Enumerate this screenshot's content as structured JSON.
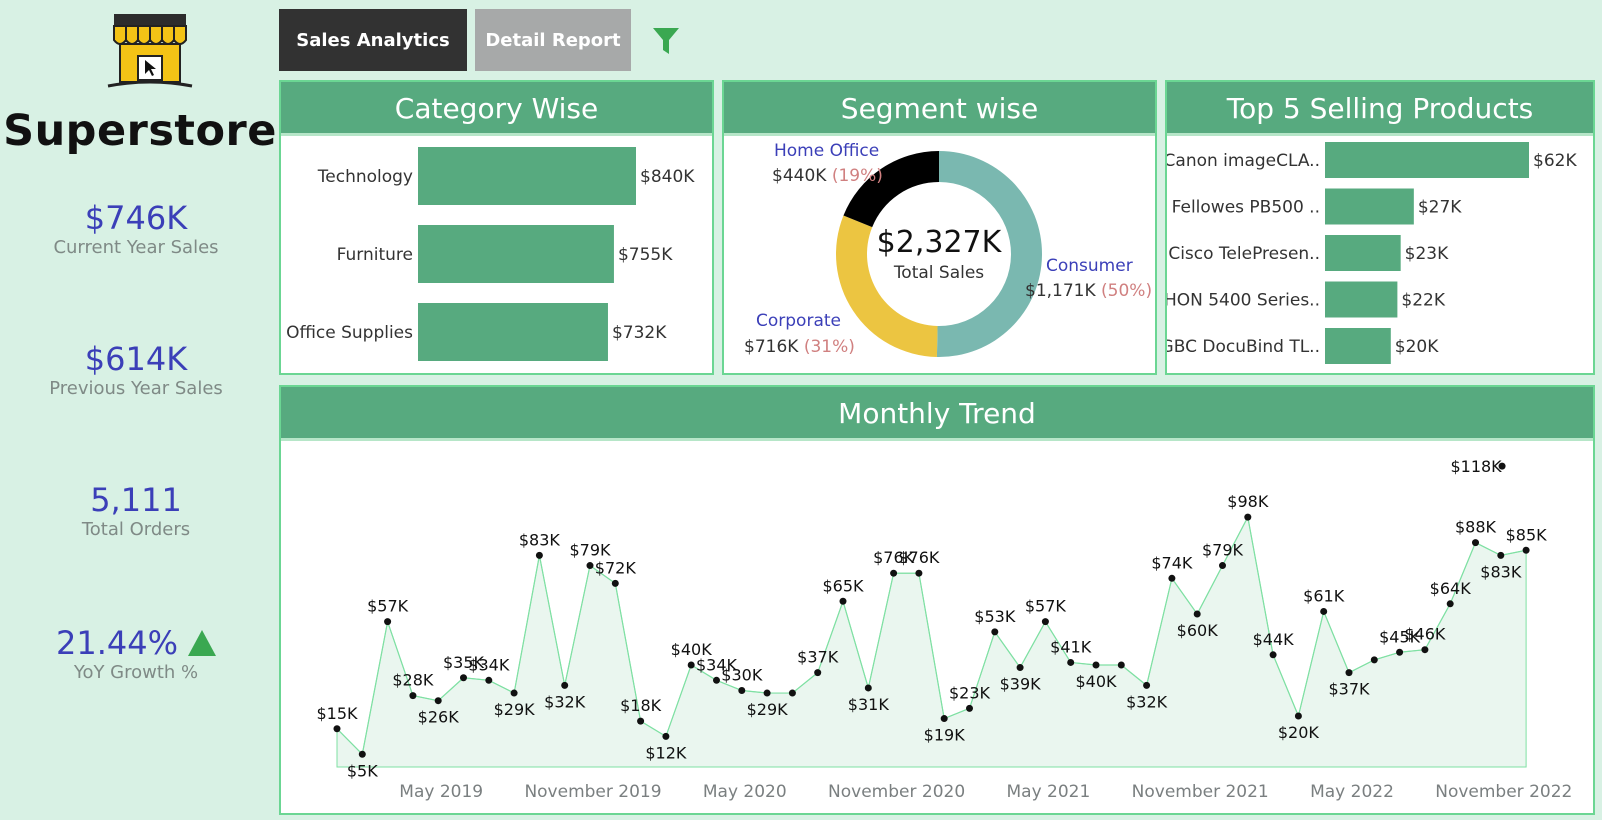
{
  "brand": {
    "name": "Superstore",
    "logo_icon": "store-cursor-icon"
  },
  "kpis": {
    "current_year": {
      "value": "$746K",
      "label": "Current Year Sales"
    },
    "previous_year": {
      "value": "$614K",
      "label": "Previous Year Sales"
    },
    "orders": {
      "value": "5,111",
      "label": "Total Orders"
    },
    "growth": {
      "value": "21.44%",
      "label": "YoY Growth %",
      "indicator_color": "#3aa851"
    }
  },
  "tabs": {
    "active": "Sales Analytics",
    "inactive": "Detail Report",
    "filter_icon": "filter-funnel-icon"
  },
  "colors": {
    "bar": "#57aa7f",
    "header": "#57aa7f",
    "kpi": "#3b3fb8",
    "consumer": "#7ab8b0",
    "corporate": "#ecc541",
    "home_office": "#000000",
    "pct": "#d08080",
    "segment_name": "#3b3fb8"
  },
  "chart_data": [
    {
      "type": "bar",
      "title": "Category Wise",
      "categories": [
        "Technology",
        "Furniture",
        "Office Supplies"
      ],
      "values": [
        840,
        755,
        732
      ],
      "labels": [
        "$840K",
        "$755K",
        "$732K"
      ]
    },
    {
      "type": "pie",
      "title": "Segment wise",
      "center_value": "$2,327K",
      "center_label": "Total Sales",
      "slices": [
        {
          "name": "Consumer",
          "value": 1171,
          "value_label": "$1,171K",
          "pct_label": "(50%)",
          "color": "#7ab8b0"
        },
        {
          "name": "Corporate",
          "value": 716,
          "value_label": "$716K",
          "pct_label": "(31%)",
          "color": "#ecc541"
        },
        {
          "name": "Home Office",
          "value": 440,
          "value_label": "$440K",
          "pct_label": "(19%)",
          "color": "#000000"
        }
      ]
    },
    {
      "type": "bar",
      "title": "Top 5 Selling Products",
      "categories": [
        "Canon imageCLA..",
        "Fellowes PB500 ..",
        "Cisco TelePresen..",
        "HON 5400 Series..",
        "GBC DocuBind TL.."
      ],
      "values": [
        62,
        27,
        23,
        22,
        20
      ],
      "labels": [
        "$62K",
        "$27K",
        "$23K",
        "$22K",
        "$20K"
      ]
    },
    {
      "type": "line",
      "title": "Monthly Trend",
      "x": [
        "2019-01",
        "2019-02",
        "2019-03",
        "2019-04",
        "2019-05",
        "2019-06",
        "2019-07",
        "2019-08",
        "2019-09",
        "2019-10",
        "2019-11",
        "2019-12",
        "2020-01",
        "2020-02",
        "2020-03",
        "2020-04",
        "2020-05",
        "2020-06",
        "2020-07",
        "2020-08",
        "2020-09",
        "2020-10",
        "2020-11",
        "2020-12",
        "2021-01",
        "2021-02",
        "2021-03",
        "2021-04",
        "2021-05",
        "2021-06",
        "2021-07",
        "2021-08",
        "2021-09",
        "2021-10",
        "2021-11",
        "2021-12",
        "2022-01",
        "2022-02",
        "2022-03",
        "2022-04",
        "2022-05",
        "2022-06",
        "2022-07",
        "2022-08",
        "2022-09",
        "2022-10",
        "2022-11",
        "2022-12"
      ],
      "values": [
        15,
        5,
        57,
        28,
        26,
        35,
        34,
        29,
        83,
        32,
        79,
        72,
        18,
        12,
        40,
        34,
        30,
        29,
        29,
        37,
        65,
        31,
        76,
        76,
        19,
        23,
        53,
        39,
        57,
        41,
        40,
        40,
        32,
        74,
        60,
        79,
        98,
        44,
        20,
        61,
        37,
        42,
        45,
        46,
        64,
        88,
        83,
        85
      ],
      "labels": [
        "$15K",
        "$5K",
        "$57K",
        "$28K",
        "$26K",
        "$35K",
        "$34K",
        "$29K",
        "$83K",
        "$32K",
        "$79K",
        "$72K",
        "$18K",
        "$12K",
        "$40K",
        "$34K",
        "$30K",
        "$29K",
        "",
        "$37K",
        "$65K",
        "$31K",
        "$76K",
        "$76K",
        "$19K",
        "$23K",
        "$53K",
        "$39K",
        "$57K",
        "$41K",
        "$40K",
        "",
        "$32K",
        "$74K",
        "$60K",
        "$79K",
        "$98K",
        "$44K",
        "$20K",
        "$61K",
        "$37K",
        "",
        "$45K",
        "$46K",
        "$64K",
        "$88K",
        "$83K",
        "$85K"
      ],
      "ylim": [
        0,
        125
      ],
      "tick_labels": [
        {
          "label": "May 2019",
          "index": 4
        },
        {
          "label": "November 2019",
          "index": 10
        },
        {
          "label": "May 2020",
          "index": 16
        },
        {
          "label": "November 2020",
          "index": 22
        },
        {
          "label": "May 2021",
          "index": 28
        },
        {
          "label": "November 2021",
          "index": 34
        },
        {
          "label": "May 2022",
          "index": 40
        },
        {
          "label": "November 2022",
          "index": 46
        }
      ],
      "peak": {
        "value": 118,
        "label": "$118K"
      },
      "line_color": "#7fe0a3",
      "area_color": "#eaf6ef"
    }
  ]
}
